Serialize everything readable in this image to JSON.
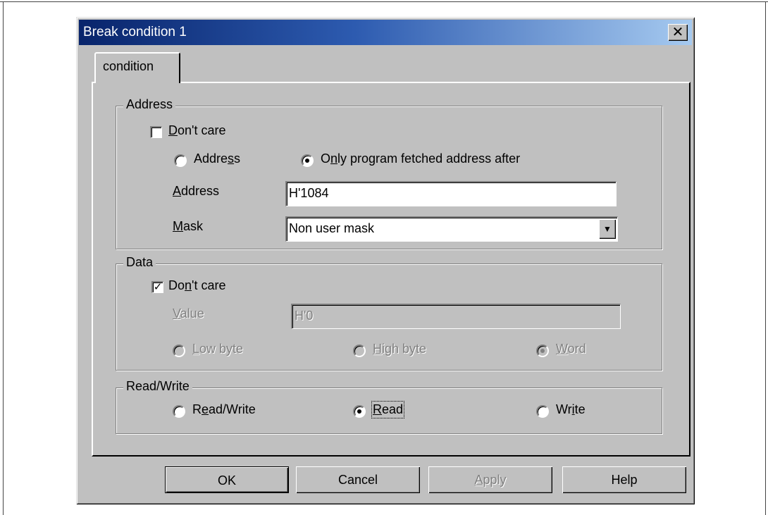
{
  "dialog": {
    "title": "Break condition 1",
    "close_glyph": "✕"
  },
  "tabs": [
    {
      "label": "condition"
    }
  ],
  "address_group": {
    "legend": "Address",
    "dont_care": {
      "pre": "",
      "accel": "D",
      "post": "on't care",
      "checked": false
    },
    "radio_address": {
      "pre": "Addre",
      "accel": "s",
      "post": "s",
      "selected": false
    },
    "radio_fetched": {
      "pre": "O",
      "accel": "n",
      "post": "ly program fetched address after",
      "selected": true
    },
    "address_label": {
      "pre": "",
      "accel": "A",
      "post": "ddress"
    },
    "address_value": "H'1084",
    "mask_label": {
      "pre": "",
      "accel": "M",
      "post": "ask"
    },
    "mask_value": "Non user mask",
    "dropdown_icon": "chevron-down-icon"
  },
  "data_group": {
    "legend": "Data",
    "dont_care": {
      "pre": "Do",
      "accel": "n",
      "post": "'t care",
      "checked": true
    },
    "value_label": {
      "pre": "",
      "accel": "V",
      "post": "alue"
    },
    "value_value": "H'0",
    "low_byte": {
      "pre": "",
      "accel": "L",
      "post": "ow byte",
      "selected": false
    },
    "high_byte": {
      "pre": "",
      "accel": "H",
      "post": "igh byte",
      "selected": false
    },
    "word": {
      "pre": "",
      "accel": "W",
      "post": "ord",
      "selected": true
    }
  },
  "rw_group": {
    "legend": "Read/Write",
    "read_write": {
      "pre": "R",
      "accel": "e",
      "post": "ad/Write",
      "selected": false
    },
    "read": {
      "pre": "",
      "accel": "R",
      "post": "ead",
      "selected": true
    },
    "write": {
      "pre": "Wr",
      "accel": "i",
      "post": "te",
      "selected": false
    }
  },
  "buttons": {
    "ok": "OK",
    "cancel": "Cancel",
    "apply": {
      "pre": "",
      "accel": "A",
      "post": "pply"
    },
    "help": "Help"
  },
  "colors": {
    "title_start": "#08246b",
    "title_end": "#a6caf0",
    "face": "#c0c0c0"
  }
}
